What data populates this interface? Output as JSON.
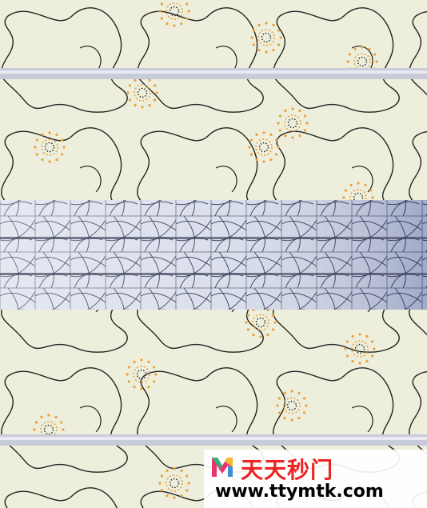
{
  "image": {
    "description_colors": {
      "background": "#eeeedd",
      "line": "#222222",
      "dots_orange": "#e9a23b",
      "dots_black": "#222222",
      "rail": "#c8cbd9",
      "tile_light": "#dfe3ee",
      "tile_dark": "#8f9ac0"
    }
  },
  "watermark": {
    "brand_cn": "天天秒门",
    "url": "www.ttymtk.com",
    "logo_colors": [
      "#e8336f",
      "#2bb673",
      "#f7b733",
      "#3b8ed8"
    ]
  }
}
